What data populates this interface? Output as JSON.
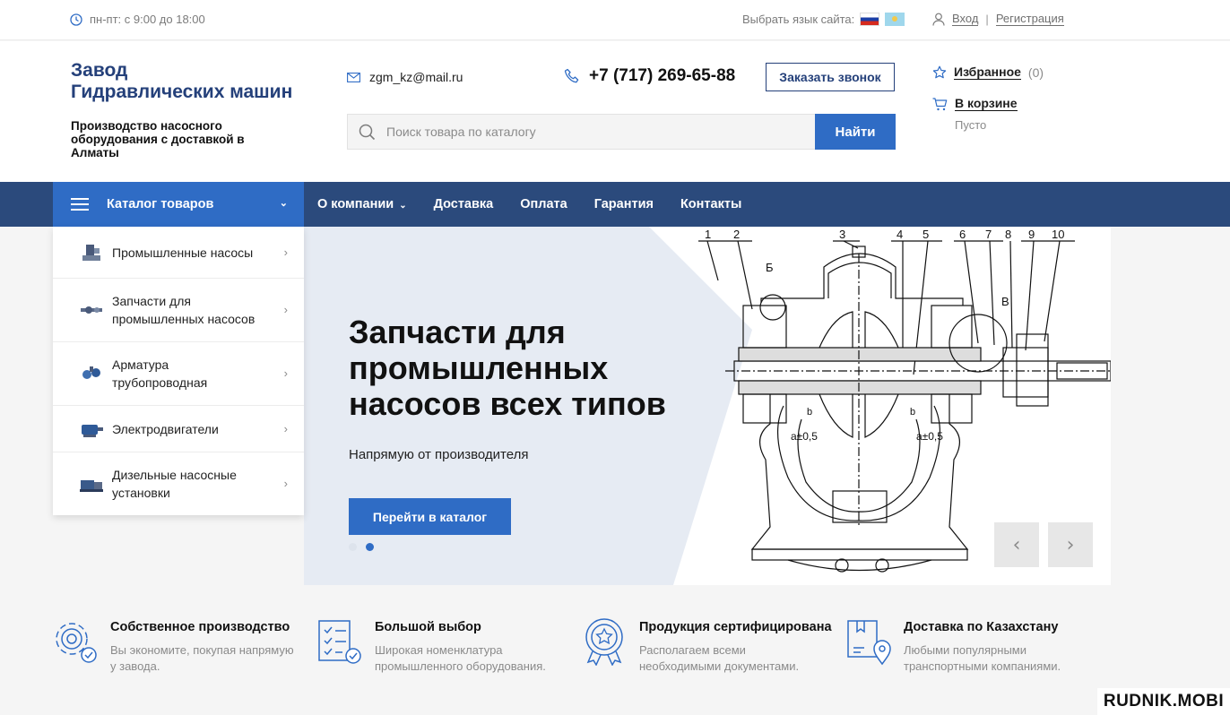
{
  "topbar": {
    "hours": "пн-пт: с 9:00 до 18:00",
    "language_label": "Выбрать язык сайта:",
    "login": "Вход",
    "register": "Регистрация"
  },
  "header": {
    "logo_line1": "Завод",
    "logo_line2": "Гидравлических машин",
    "tagline": "Производство насосного оборудования с доставкой в Алматы",
    "email": "zgm_kz@mail.ru",
    "phone": "+7 (717) 269-65-88",
    "callback_label": "Заказать звонок",
    "search_placeholder": "Поиск товара по каталогу",
    "search_button": "Найти",
    "favorites_label": "Избранное",
    "favorites_count": "(0)",
    "cart_label": "В корзине",
    "cart_status": "Пусто"
  },
  "nav": {
    "catalog_label": "Каталог товаров",
    "links": [
      "О компании",
      "Доставка",
      "Оплата",
      "Гарантия",
      "Контакты"
    ]
  },
  "catalog_menu": [
    {
      "label": "Промышленные насосы"
    },
    {
      "label": "Запчасти для промышленных насосов"
    },
    {
      "label": "Арматура трубопроводная"
    },
    {
      "label": "Электродвигатели"
    },
    {
      "label": "Дизельные насосные установки"
    }
  ],
  "hero": {
    "title": "Запчасти для промышленных насосов всех типов",
    "subtitle": "Напрямую от производителя",
    "button": "Перейти в каталог",
    "slide_count": 2,
    "active_slide": 2,
    "drawing_labels": [
      "1",
      "2",
      "3",
      "4",
      "5",
      "6",
      "7",
      "8",
      "9",
      "10",
      "Б",
      "В",
      "а±0,5",
      "а±0,5",
      "b",
      "b"
    ]
  },
  "features": [
    {
      "title": "Собственное производство",
      "desc": "Вы экономите, покупая напрямую у завода.",
      "icon": "gear-check-icon"
    },
    {
      "title": "Большой выбор",
      "desc": "Широкая номенклатура промышленного оборудования.",
      "icon": "checklist-icon"
    },
    {
      "title": "Продукция сертифицирована",
      "desc": "Располагаем всеми необходимыми документами.",
      "icon": "certificate-icon"
    },
    {
      "title": "Доставка по Казахстану",
      "desc": "Любыми популярными транспортными компаниями.",
      "icon": "map-pin-icon"
    }
  ],
  "watermark": "RUDNIK.MOBI",
  "colors": {
    "accent": "#2f6cc5",
    "nav_bg": "#2b4a7c",
    "logo": "#24407a"
  }
}
